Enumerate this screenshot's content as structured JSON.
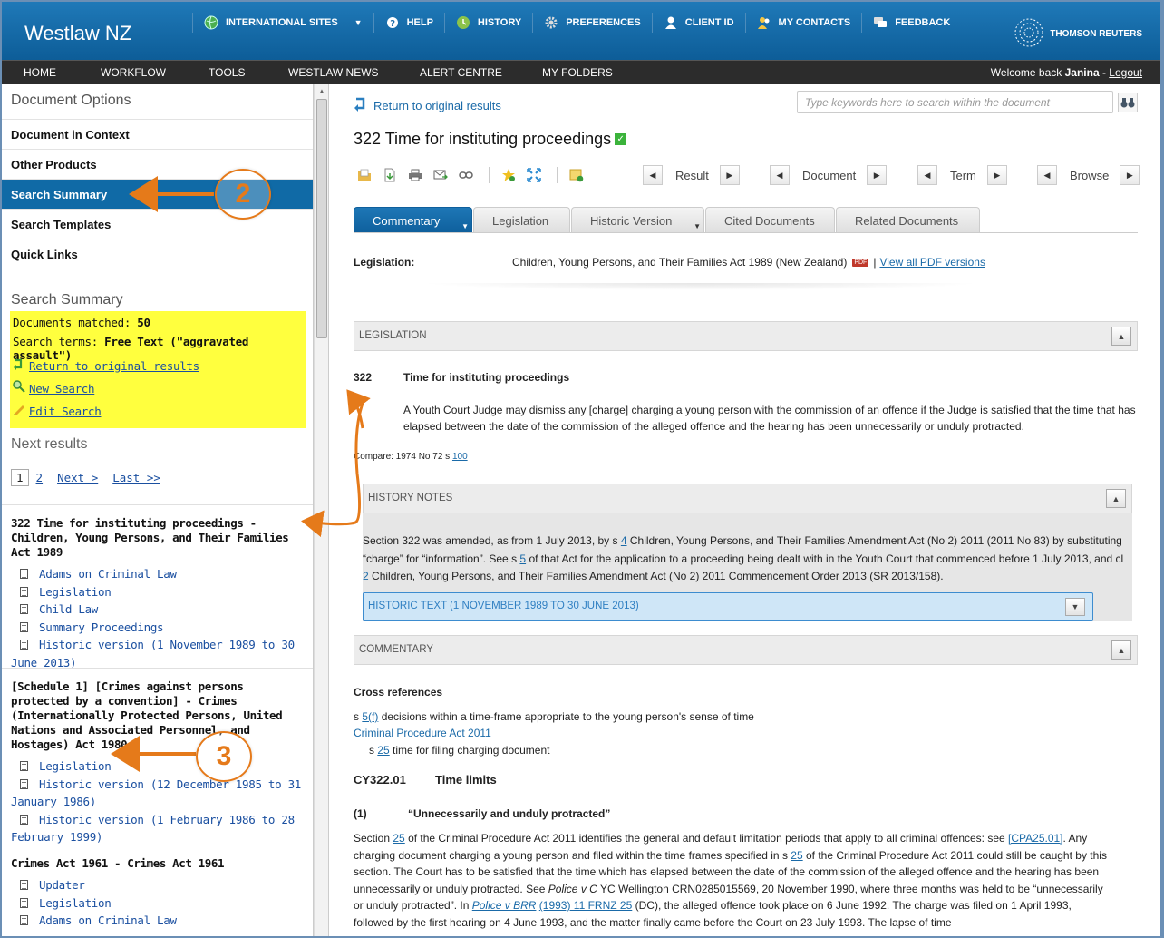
{
  "header": {
    "brand": "Westlaw NZ",
    "nav": [
      {
        "label": "INTERNATIONAL SITES",
        "icon": "globe-icon"
      },
      {
        "label": "HELP",
        "icon": "help-icon"
      },
      {
        "label": "HISTORY",
        "icon": "history-icon"
      },
      {
        "label": "PREFERENCES",
        "icon": "gear-icon"
      },
      {
        "label": "CLIENT ID",
        "icon": "user-icon"
      },
      {
        "label": "MY CONTACTS",
        "icon": "contacts-icon"
      },
      {
        "label": "FEEDBACK",
        "icon": "feedback-icon"
      }
    ],
    "publisher": "THOMSON REUTERS"
  },
  "menubar": {
    "items": [
      "HOME",
      "WORKFLOW",
      "TOOLS",
      "WESTLAW NEWS",
      "ALERT CENTRE",
      "MY FOLDERS"
    ],
    "welcome_prefix": "Welcome back",
    "user": "Janina",
    "logout": "Logout"
  },
  "sidebar": {
    "options_heading": "Document Options",
    "options": [
      "Document in Context",
      "Other Products",
      "Search Summary",
      "Search Templates",
      "Quick Links"
    ],
    "summary_heading": "Search Summary",
    "docs_matched_label": "Documents matched:",
    "docs_matched_value": "50",
    "search_terms_label": "Search terms:",
    "search_terms_value": "Free Text (\"aggravated assault\")",
    "links": [
      "Return to original results",
      "New Search",
      "Edit Search"
    ],
    "next_heading": "Next results",
    "pager": {
      "current": "1",
      "page2": "2",
      "next": "Next >",
      "last": "Last >>"
    },
    "results": [
      {
        "title": "322 Time for instituting proceedings - Children, Young Persons, and Their Families Act 1989",
        "items": [
          "Adams on Criminal Law",
          "Legislation",
          "Child Law",
          "Summary Proceedings",
          "Historic version (1 November 1989 to 30 June 2013)"
        ]
      },
      {
        "title": "[Schedule 1] [Crimes against persons protected by a convention] - Crimes (Internationally Protected Persons, United Nations and Associated Personnel, and Hostages) Act 1980",
        "items": [
          "Legislation",
          "Historic version (12 December 1985 to 31 January 1986)",
          "Historic version (1 February 1986 to 28 February 1999)"
        ]
      },
      {
        "title": "Crimes Act 1961 - Crimes Act 1961",
        "items": [
          "Updater",
          "Legislation",
          "Adams on Criminal Law"
        ]
      }
    ]
  },
  "main": {
    "return_link": "Return to original results",
    "search_placeholder": "Type keywords here to search within the document",
    "title": "322 Time for instituting proceedings",
    "nav_groups": [
      "Result",
      "Document",
      "Term",
      "Browse"
    ],
    "tabs": [
      "Commentary",
      "Legislation",
      "Historic Version",
      "Cited Documents",
      "Related Documents"
    ],
    "legislation_label": "Legislation:",
    "legislation_value": "Children, Young Persons, and Their Families Act 1989 (New Zealand)",
    "pdf_badge": "PDF",
    "pdf_sep": "|",
    "view_pdf": "View all PDF versions",
    "legislation_bar": "LEGISLATION",
    "section_number": "322",
    "section_title": "Time for instituting proceedings",
    "section_text": "A Youth Court Judge may dismiss any [charge] charging a young person with the commission of an offence if the Judge is satisfied that the time that has elapsed between the date of the commission of the alleged offence and the hearing has been unnecessarily or unduly protracted.",
    "compare_prefix": "Compare: 1974 No 72 s",
    "compare_link": "100",
    "history_bar": "HISTORY NOTES",
    "history_p1": "Section 322 was amended, as from 1 July 2013, by s",
    "history_l1": "4",
    "history_p2": "Children, Young Persons, and Their Families Amendment Act (No 2) 2011 (2011 No 83) by substituting “charge” for “information”. See s",
    "history_l2": "5",
    "history_p3": "of that Act for the application to a proceeding being dealt with in the Youth Court that commenced before 1 July 2013, and cl",
    "history_l3": "2",
    "history_p4": "Children, Young Persons, and Their Families Amendment Act (No 2) 2011 Commencement Order 2013 (SR 2013/158).",
    "historic_text_bar": "HISTORIC TEXT (1 NOVEMBER 1989 TO 30 JUNE 2013)",
    "commentary_bar": "COMMENTARY",
    "cross_refs_heading": "Cross references",
    "cr1_prefix": "s",
    "cr1_link": "5(f)",
    "cr1_text": "decisions within a time-frame appropriate to the young person's sense of time",
    "cr2_link": "Criminal Procedure Act 2011",
    "cr3_prefix": "s",
    "cr3_link": "25",
    "cr3_text": "time for filing charging document",
    "cy_number": "CY322.01",
    "cy_title": "Time limits",
    "sub_number": "(1)",
    "sub_title": "“Unnecessarily and unduly protracted”",
    "para_a": "Section",
    "para_l1": "25",
    "para_b": "of the Criminal Procedure Act 2011 identifies the general and default limitation periods that apply to all criminal offences: see",
    "para_l2": "[CPA25.01]",
    "para_c": ". Any charging document charging a young person and filed within the time frames specified in s",
    "para_l3": "25",
    "para_d": "of the Criminal Procedure Act 2011 could still be caught by this section. The Court has to be satisfied that the time which has elapsed between the date of the commission of the alleged offence and the hearing has been unnecessarily or unduly protracted. See",
    "para_case1": "Police v C",
    "para_e": "YC Wellington CRN0285015569, 20 November 1990, where three months was held to be “unnecessarily or unduly protracted”. In",
    "para_l4": "Police v BRR",
    "para_l5": "(1993) 11 FRNZ 25",
    "para_f": "(DC), the alleged offence took place on 6 June 1992. The charge was filed on 1 April 1993, followed by the first hearing on 4 June 1993, and the matter finally came before the Court on 23 July 1993. The lapse of time"
  },
  "annotations": [
    "2",
    "3"
  ],
  "colors": {
    "header": "#1a70ad",
    "accent": "#106aa6",
    "highlight": "#ffff3e",
    "annotation": "#e57a1a"
  }
}
